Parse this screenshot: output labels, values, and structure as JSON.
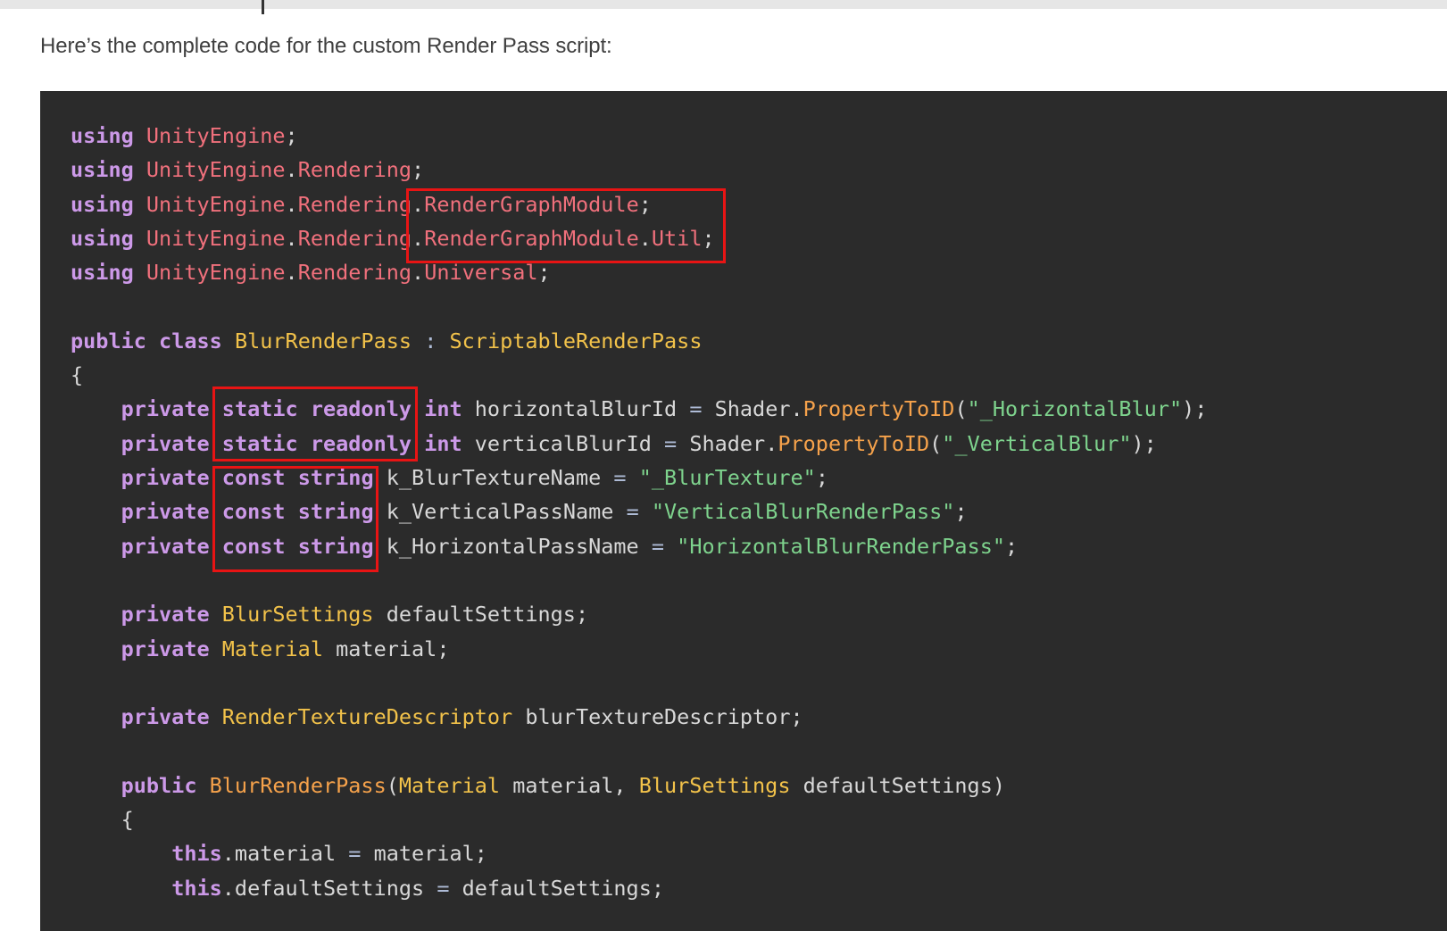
{
  "intro_text": "Here’s the complete code for the custom Render Pass script:",
  "code_lines": [
    [
      [
        "kw",
        "using"
      ],
      [
        "id",
        " "
      ],
      [
        "ns",
        "UnityEngine"
      ],
      [
        "punct",
        ";"
      ]
    ],
    [
      [
        "kw",
        "using"
      ],
      [
        "id",
        " "
      ],
      [
        "ns",
        "UnityEngine"
      ],
      [
        "punct",
        "."
      ],
      [
        "ns",
        "Rendering"
      ],
      [
        "punct",
        ";"
      ]
    ],
    [
      [
        "kw",
        "using"
      ],
      [
        "id",
        " "
      ],
      [
        "ns",
        "UnityEngine"
      ],
      [
        "punct",
        "."
      ],
      [
        "ns",
        "Rendering"
      ],
      [
        "punct",
        "."
      ],
      [
        "ns",
        "RenderGraphModule"
      ],
      [
        "punct",
        ";"
      ]
    ],
    [
      [
        "kw",
        "using"
      ],
      [
        "id",
        " "
      ],
      [
        "ns",
        "UnityEngine"
      ],
      [
        "punct",
        "."
      ],
      [
        "ns",
        "Rendering"
      ],
      [
        "punct",
        "."
      ],
      [
        "ns",
        "RenderGraphModule"
      ],
      [
        "punct",
        "."
      ],
      [
        "ns",
        "Util"
      ],
      [
        "punct",
        ";"
      ]
    ],
    [
      [
        "kw",
        "using"
      ],
      [
        "id",
        " "
      ],
      [
        "ns",
        "UnityEngine"
      ],
      [
        "punct",
        "."
      ],
      [
        "ns",
        "Rendering"
      ],
      [
        "punct",
        "."
      ],
      [
        "ns",
        "Universal"
      ],
      [
        "punct",
        ";"
      ]
    ],
    [],
    [
      [
        "kw",
        "public"
      ],
      [
        "id",
        " "
      ],
      [
        "kw",
        "class"
      ],
      [
        "id",
        " "
      ],
      [
        "type",
        "BlurRenderPass"
      ],
      [
        "id",
        " "
      ],
      [
        "op",
        ":"
      ],
      [
        "id",
        " "
      ],
      [
        "type",
        "ScriptableRenderPass"
      ]
    ],
    [
      [
        "punct",
        "{"
      ]
    ],
    [
      [
        "id",
        "    "
      ],
      [
        "kw",
        "private"
      ],
      [
        "id",
        " "
      ],
      [
        "kw",
        "static"
      ],
      [
        "id",
        " "
      ],
      [
        "kw",
        "readonly"
      ],
      [
        "id",
        " "
      ],
      [
        "kw",
        "int"
      ],
      [
        "id",
        " horizontalBlurId "
      ],
      [
        "op",
        "="
      ],
      [
        "id",
        " Shader."
      ],
      [
        "method",
        "PropertyToID"
      ],
      [
        "punct",
        "("
      ],
      [
        "str",
        "\"_HorizontalBlur\""
      ],
      [
        "punct",
        ");"
      ]
    ],
    [
      [
        "id",
        "    "
      ],
      [
        "kw",
        "private"
      ],
      [
        "id",
        " "
      ],
      [
        "kw",
        "static"
      ],
      [
        "id",
        " "
      ],
      [
        "kw",
        "readonly"
      ],
      [
        "id",
        " "
      ],
      [
        "kw",
        "int"
      ],
      [
        "id",
        " verticalBlurId "
      ],
      [
        "op",
        "="
      ],
      [
        "id",
        " Shader."
      ],
      [
        "method",
        "PropertyToID"
      ],
      [
        "punct",
        "("
      ],
      [
        "str",
        "\"_VerticalBlur\""
      ],
      [
        "punct",
        ");"
      ]
    ],
    [
      [
        "id",
        "    "
      ],
      [
        "kw",
        "private"
      ],
      [
        "id",
        " "
      ],
      [
        "kw",
        "const"
      ],
      [
        "id",
        " "
      ],
      [
        "kw",
        "string"
      ],
      [
        "id",
        " k_BlurTextureName "
      ],
      [
        "op",
        "="
      ],
      [
        "id",
        " "
      ],
      [
        "str",
        "\"_BlurTexture\""
      ],
      [
        "punct",
        ";"
      ]
    ],
    [
      [
        "id",
        "    "
      ],
      [
        "kw",
        "private"
      ],
      [
        "id",
        " "
      ],
      [
        "kw",
        "const"
      ],
      [
        "id",
        " "
      ],
      [
        "kw",
        "string"
      ],
      [
        "id",
        " k_VerticalPassName "
      ],
      [
        "op",
        "="
      ],
      [
        "id",
        " "
      ],
      [
        "str",
        "\"VerticalBlurRenderPass\""
      ],
      [
        "punct",
        ";"
      ]
    ],
    [
      [
        "id",
        "    "
      ],
      [
        "kw",
        "private"
      ],
      [
        "id",
        " "
      ],
      [
        "kw",
        "const"
      ],
      [
        "id",
        " "
      ],
      [
        "kw",
        "string"
      ],
      [
        "id",
        " k_HorizontalPassName "
      ],
      [
        "op",
        "="
      ],
      [
        "id",
        " "
      ],
      [
        "str",
        "\"HorizontalBlurRenderPass\""
      ],
      [
        "punct",
        ";"
      ]
    ],
    [],
    [
      [
        "id",
        "    "
      ],
      [
        "kw",
        "private"
      ],
      [
        "id",
        " "
      ],
      [
        "type",
        "BlurSettings"
      ],
      [
        "id",
        " defaultSettings;"
      ]
    ],
    [
      [
        "id",
        "    "
      ],
      [
        "kw",
        "private"
      ],
      [
        "id",
        " "
      ],
      [
        "type",
        "Material"
      ],
      [
        "id",
        " material;"
      ]
    ],
    [],
    [
      [
        "id",
        "    "
      ],
      [
        "kw",
        "private"
      ],
      [
        "id",
        " "
      ],
      [
        "type",
        "RenderTextureDescriptor"
      ],
      [
        "id",
        " blurTextureDescriptor;"
      ]
    ],
    [],
    [
      [
        "id",
        "    "
      ],
      [
        "kw",
        "public"
      ],
      [
        "id",
        " "
      ],
      [
        "method",
        "BlurRenderPass"
      ],
      [
        "punct",
        "("
      ],
      [
        "type",
        "Material"
      ],
      [
        "id",
        " material, "
      ],
      [
        "type",
        "BlurSettings"
      ],
      [
        "id",
        " defaultSettings)"
      ]
    ],
    [
      [
        "id",
        "    "
      ],
      [
        "punct",
        "{"
      ]
    ],
    [
      [
        "id",
        "        "
      ],
      [
        "kw",
        "this"
      ],
      [
        "id",
        ".material "
      ],
      [
        "op",
        "="
      ],
      [
        "id",
        " material;"
      ]
    ],
    [
      [
        "id",
        "        "
      ],
      [
        "kw",
        "this"
      ],
      [
        "id",
        ".defaultSettings "
      ],
      [
        "op",
        "="
      ],
      [
        "id",
        " defaultSettings;"
      ]
    ]
  ],
  "colors": {
    "background": "#2b2b2b",
    "keyword": "#cc99e8",
    "namespace": "#f0707c",
    "type": "#f2c24a",
    "method": "#f6a24b",
    "string": "#7ed38d",
    "highlight_box": "#e81414"
  }
}
